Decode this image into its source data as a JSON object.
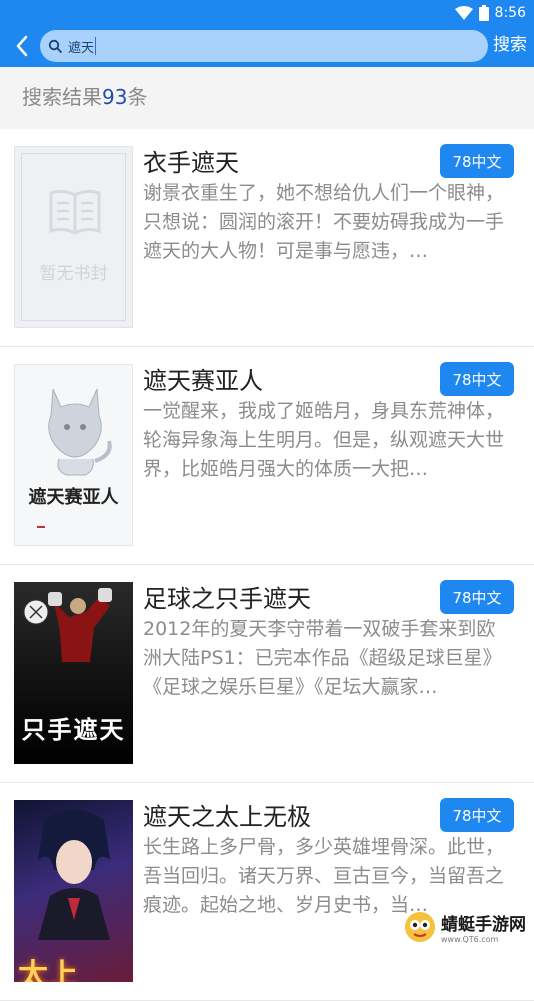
{
  "status_bar": {
    "time": "8:56"
  },
  "header": {
    "search_query": "遮天",
    "search_button": "搜索"
  },
  "results": {
    "prefix": "搜索结果",
    "count": "93",
    "suffix": "条"
  },
  "books": [
    {
      "title": "衣手遮天",
      "badge": "78中文",
      "description": "谢景衣重生了，她不想给仇人们一个眼神，只想说：圆润的滚开！不要妨碍我成为一手遮天的大人物！可是事与愿违，…",
      "cover_text": "暂无书封",
      "cover_type": "placeholder"
    },
    {
      "title": "遮天赛亚人",
      "badge": "78中文",
      "description": "一觉醒来，我成了姬皓月，身具东荒神体，轮海异象海上生明月。但是，纵观遮天大世界，比姬皓月强大的体质一大把…",
      "cover_text": "遮天赛亚人",
      "cover_type": "illustrated"
    },
    {
      "title": "足球之只手遮天",
      "badge": "78中文",
      "description": "2012年的夏天李守带着一双破手套来到欧洲大陆PS1：已完本作品《超级足球巨星》《足球之娱乐巨星》《足坛大赢家…",
      "cover_text": "只手遮天",
      "cover_type": "photo"
    },
    {
      "title": "遮天之太上无极",
      "badge": "78中文",
      "description": "长生路上多尸骨，多少英雄埋骨深。此世，吾当回归。诸天万界、亘古亘今，当留吾之痕迹。起始之地、岁月史书，当…",
      "cover_text": "太上",
      "cover_type": "anime"
    }
  ],
  "watermark": {
    "text": "蜻蜓手游网",
    "url": "www.QT6.com"
  },
  "colors": {
    "primary": "#1e88f0",
    "search_bg": "#a8d1fb",
    "count_accent": "#1f4fb0"
  }
}
